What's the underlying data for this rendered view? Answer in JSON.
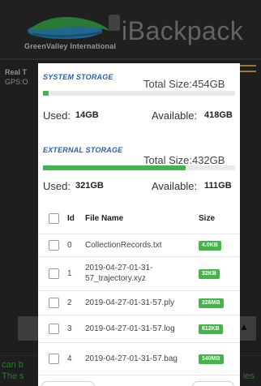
{
  "app": {
    "brand_title": "iBackpack",
    "logo_caption": "GreenValley International",
    "status_line1": "Real T",
    "status_line2": "GPS:O",
    "console_line1": "can b",
    "console_line2": "The s",
    "console_tail": "ies"
  },
  "dialog": {
    "system_storage": {
      "heading": "SYSTEM STORAGE",
      "total": "Total Size:454GB",
      "used_label": "Used:",
      "used_value": "14GB",
      "available_label": "Available:",
      "available_value": "418GB",
      "used_fraction": 0.031
    },
    "external_storage": {
      "heading": "EXTERNAL STORAGE",
      "total": "Total Size:432GB",
      "used_label": "Used:",
      "used_value": "321GB",
      "available_label": "Available:",
      "available_value": "111GB",
      "used_fraction": 0.743
    },
    "table": {
      "headers": {
        "id": "Id",
        "name": "File Name",
        "size": "Size"
      },
      "rows": [
        {
          "id": "0",
          "name": "CollectionRecords.txt",
          "size": "4.0KB"
        },
        {
          "id": "1",
          "name": "2019-04-27-01-31-57_trajectory.xyz",
          "size": "32KB"
        },
        {
          "id": "2",
          "name": "2019-04-27-01-31-57.ply",
          "size": "226MB"
        },
        {
          "id": "3",
          "name": "2019-04-27-01-31-57.log",
          "size": "612KB"
        },
        {
          "id": "4",
          "name": "2019-04-27-01-31-57.bag",
          "size": "140MB"
        }
      ]
    }
  },
  "colors": {
    "accent_green": "#45b54a",
    "heading_blue": "#2b5fa8",
    "menu_orange": "#d8a640"
  }
}
